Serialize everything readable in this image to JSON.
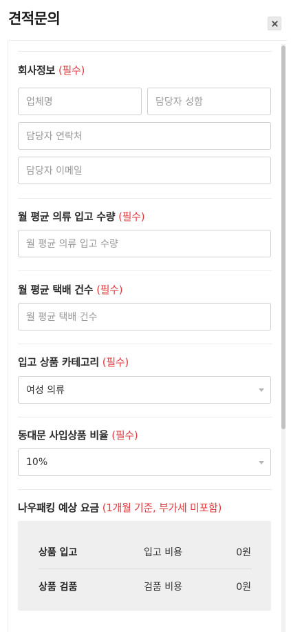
{
  "header": {
    "title": "견적문의"
  },
  "company": {
    "label": "회사정보",
    "required": "(필수)",
    "company_name_placeholder": "업체명",
    "manager_name_placeholder": "담당자 성함",
    "manager_phone_placeholder": "담당자 연락처",
    "manager_email_placeholder": "담당자 이메일"
  },
  "clothing_volume": {
    "label": "월 평균 의류 입고 수량",
    "required": "(필수)",
    "placeholder": "월 평균 의류 입고 수량"
  },
  "delivery_count": {
    "label": "월 평균 택배 건수",
    "required": "(필수)",
    "placeholder": "월 평균 택배 건수"
  },
  "category": {
    "label": "입고 상품 카테고리",
    "required": "(필수)",
    "selected": "여성 의류"
  },
  "dongdaemun_ratio": {
    "label": "동대문 사입상품 비율",
    "required": "(필수)",
    "selected": "10%"
  },
  "estimate": {
    "label": "나우패킹 예상 요금",
    "note": "(1개월 기준, 부가세 미포함)",
    "rows": [
      {
        "name": "상품 입고",
        "cost_label": "입고 비용",
        "cost_value": "0원"
      },
      {
        "name": "상품 검품",
        "cost_label": "검품 비용",
        "cost_value": "0원"
      }
    ]
  },
  "colors": {
    "required": "#e0393e",
    "border": "#cfcfcf",
    "estimate_bg": "#efefef"
  },
  "icons": {
    "close": "close-icon",
    "dropdown": "chevron-down-icon"
  }
}
